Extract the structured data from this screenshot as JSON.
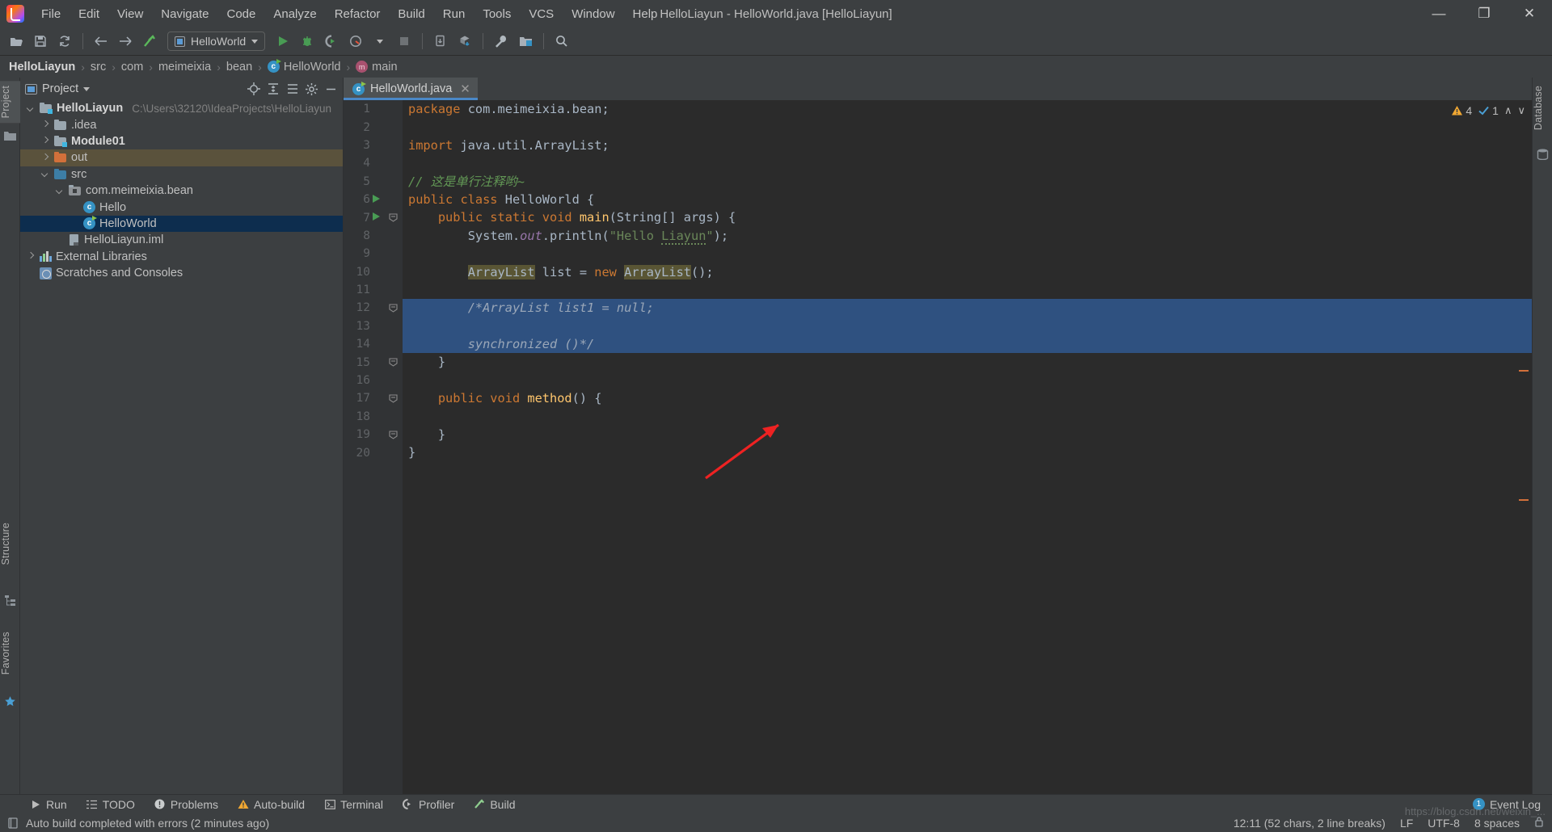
{
  "window": {
    "title": "HelloLiayun - HelloWorld.java [HelloLiayun]",
    "minimize": "—",
    "maximize": "❐",
    "close": "✕"
  },
  "menu": {
    "items": [
      "File",
      "Edit",
      "View",
      "Navigate",
      "Code",
      "Analyze",
      "Refactor",
      "Build",
      "Run",
      "Tools",
      "VCS",
      "Window",
      "Help"
    ]
  },
  "toolbar": {
    "open_label": "open-folder",
    "save_label": "save-all",
    "sync_label": "sync",
    "back_label": "back",
    "forward_label": "forward",
    "build_label": "build-project",
    "run_config": "HelloWorld",
    "run_label": "run",
    "debug_label": "debug",
    "coverage_label": "run-with-coverage",
    "profile_label": "profile",
    "stop_label": "stop",
    "update_label": "update-project",
    "commit_label": "commit",
    "settings_label": "settings",
    "project_structure_label": "project-structure",
    "search_label": "search-everywhere"
  },
  "breadcrumb": {
    "items": [
      {
        "label": "HelloLiayun",
        "icon": "none",
        "strong": true
      },
      {
        "label": "src",
        "icon": "none",
        "strong": false
      },
      {
        "label": "com",
        "icon": "none",
        "strong": false
      },
      {
        "label": "meimeixia",
        "icon": "none",
        "strong": false
      },
      {
        "label": "bean",
        "icon": "none",
        "strong": false
      },
      {
        "label": "HelloWorld",
        "icon": "class",
        "strong": false
      },
      {
        "label": "main",
        "icon": "method",
        "strong": false
      }
    ],
    "separator": "›"
  },
  "left_strip": {
    "project_tab": "Project",
    "structure_tab": "Structure",
    "favorites_tab": "Favorites"
  },
  "right_strip": {
    "database_tab": "Database"
  },
  "project_panel": {
    "title": "Project",
    "caret": "▾",
    "actions": [
      "locate-icon",
      "expand-all-icon",
      "collapse-all-icon",
      "gear-icon",
      "hide-icon"
    ],
    "tree": [
      {
        "indent": 0,
        "arrow": "down",
        "icon": "module",
        "label": "HelloLiayun",
        "bold": true,
        "path": "C:\\Users\\32120\\IdeaProjects\\HelloLiayun",
        "state": "none"
      },
      {
        "indent": 1,
        "arrow": "right",
        "icon": "folder",
        "label": ".idea",
        "bold": false,
        "path": "",
        "state": "none"
      },
      {
        "indent": 1,
        "arrow": "right",
        "icon": "module",
        "label": "Module01",
        "bold": true,
        "path": "",
        "state": "none"
      },
      {
        "indent": 1,
        "arrow": "right",
        "icon": "orange",
        "label": "out",
        "bold": false,
        "path": "",
        "state": "highlight"
      },
      {
        "indent": 1,
        "arrow": "down",
        "icon": "blue",
        "label": "src",
        "bold": false,
        "path": "",
        "state": "none"
      },
      {
        "indent": 2,
        "arrow": "down",
        "icon": "pkg",
        "label": "com.meimeixia.bean",
        "bold": false,
        "path": "",
        "state": "none"
      },
      {
        "indent": 3,
        "arrow": "none",
        "icon": "class",
        "label": "Hello",
        "bold": false,
        "path": "",
        "state": "none"
      },
      {
        "indent": 3,
        "arrow": "none",
        "icon": "class-run",
        "label": "HelloWorld",
        "bold": false,
        "path": "",
        "state": "selected"
      },
      {
        "indent": 2,
        "arrow": "none",
        "icon": "iml",
        "label": "HelloLiayun.iml",
        "bold": false,
        "path": "",
        "state": "none"
      },
      {
        "indent": 0,
        "arrow": "right",
        "icon": "lib",
        "label": "External Libraries",
        "bold": false,
        "path": "",
        "state": "none"
      },
      {
        "indent": 0,
        "arrow": "none",
        "icon": "scratch",
        "label": "Scratches and Consoles",
        "bold": false,
        "path": "",
        "state": "none"
      }
    ]
  },
  "editor": {
    "tab": {
      "label": "HelloWorld.java",
      "close": "✕",
      "icon": "class-run"
    },
    "inspection": {
      "warn_count": "4",
      "warn_icon": "warning-triangle",
      "ok_count": "1",
      "ok_icon": "check-mark",
      "up": "∧",
      "down": "∨"
    },
    "line_numbers": [
      "1",
      "2",
      "3",
      "4",
      "5",
      "6",
      "7",
      "8",
      "9",
      "10",
      "11",
      "12",
      "13",
      "14",
      "15",
      "16",
      "17",
      "18",
      "19",
      "20"
    ],
    "lines": [
      {
        "n": 1,
        "indent": 0,
        "tokens": [
          {
            "t": "package ",
            "c": "kw"
          },
          {
            "t": "com.meimeixia.bean;",
            "c": "plain"
          }
        ]
      },
      {
        "n": 2,
        "indent": 0,
        "tokens": []
      },
      {
        "n": 3,
        "indent": 0,
        "tokens": [
          {
            "t": "import ",
            "c": "kw"
          },
          {
            "t": "java.util.ArrayList;",
            "c": "plain"
          }
        ]
      },
      {
        "n": 4,
        "indent": 0,
        "tokens": []
      },
      {
        "n": 5,
        "indent": 0,
        "tokens": [
          {
            "t": "// 这是单行注释哟~",
            "c": "cmt"
          }
        ]
      },
      {
        "n": 6,
        "indent": 0,
        "tokens": [
          {
            "t": "public class ",
            "c": "kw"
          },
          {
            "t": "HelloWorld",
            "c": "plain"
          },
          {
            "t": " {",
            "c": "plain"
          }
        ],
        "run_marker": true
      },
      {
        "n": 7,
        "indent": 1,
        "tokens": [
          {
            "t": "public static void ",
            "c": "kw"
          },
          {
            "t": "main",
            "c": "fn"
          },
          {
            "t": "(String[] args) {",
            "c": "plain"
          }
        ],
        "run_marker": true,
        "fold": true
      },
      {
        "n": 8,
        "indent": 2,
        "tokens": [
          {
            "t": "System.",
            "c": "plain"
          },
          {
            "t": "out",
            "c": "fld"
          },
          {
            "t": ".println(",
            "c": "plain"
          },
          {
            "t": "\"Hello ",
            "c": "str"
          },
          {
            "t": "Liayun",
            "c": "str-squiggle"
          },
          {
            "t": "\"",
            "c": "str"
          },
          {
            "t": ");",
            "c": "plain"
          }
        ]
      },
      {
        "n": 9,
        "indent": 0,
        "tokens": []
      },
      {
        "n": 10,
        "indent": 2,
        "tokens": [
          {
            "t": "ArrayList",
            "c": "hlid"
          },
          {
            "t": " list = ",
            "c": "plain"
          },
          {
            "t": "new ",
            "c": "kw"
          },
          {
            "t": "ArrayList",
            "c": "hlid"
          },
          {
            "t": "();",
            "c": "plain"
          }
        ]
      },
      {
        "n": 11,
        "indent": 0,
        "tokens": []
      },
      {
        "n": 12,
        "indent": 2,
        "tokens": [
          {
            "t": "/*ArrayList list1 = null;",
            "c": "cmt-sel"
          }
        ],
        "selected": true,
        "bulb": true,
        "fold": true
      },
      {
        "n": 13,
        "indent": 0,
        "tokens": [],
        "selected": true
      },
      {
        "n": 14,
        "indent": 2,
        "tokens": [
          {
            "t": "synchronized ()*/",
            "c": "cmt-sel"
          }
        ],
        "selected": true
      },
      {
        "n": 15,
        "indent": 1,
        "tokens": [
          {
            "t": "}",
            "c": "plain"
          }
        ],
        "fold": true
      },
      {
        "n": 16,
        "indent": 0,
        "tokens": []
      },
      {
        "n": 17,
        "indent": 1,
        "tokens": [
          {
            "t": "public void ",
            "c": "kw"
          },
          {
            "t": "method",
            "c": "fn"
          },
          {
            "t": "() {",
            "c": "plain"
          }
        ],
        "fold": true
      },
      {
        "n": 18,
        "indent": 0,
        "tokens": []
      },
      {
        "n": 19,
        "indent": 1,
        "tokens": [
          {
            "t": "}",
            "c": "plain"
          }
        ],
        "fold": true
      },
      {
        "n": 20,
        "indent": 0,
        "tokens": [
          {
            "t": "}",
            "c": "plain"
          }
        ]
      }
    ]
  },
  "bottom_tabs": [
    {
      "label": "Run",
      "icon": "play-icon"
    },
    {
      "label": "TODO",
      "icon": "list-icon"
    },
    {
      "label": "Problems",
      "icon": "error-icon"
    },
    {
      "label": "Auto-build",
      "icon": "warning-icon"
    },
    {
      "label": "Terminal",
      "icon": "terminal-icon"
    },
    {
      "label": "Profiler",
      "icon": "profiler-icon"
    },
    {
      "label": "Build",
      "icon": "hammer-icon"
    }
  ],
  "event_log": {
    "label": "Event Log",
    "count": "1"
  },
  "status": {
    "message": "Auto build completed with errors (2 minutes ago)",
    "caret": "12:11 (52 chars, 2 line breaks)",
    "line_sep": "LF",
    "encoding": "UTF-8",
    "indent": "8 spaces"
  },
  "watermark": "https://blog.csdn.net/weixin_...",
  "colors": {
    "accent_blue": "#4a88c7",
    "selection": "#2f5180",
    "tree_selection": "#0d2d4e",
    "editor_bg": "#2b2b2b",
    "panel_bg": "#3c3f41",
    "gutter_bg": "#313335",
    "keyword": "#cc7832",
    "string": "#6a8759",
    "comment": "#629755",
    "field": "#9876aa",
    "method": "#ffc66d",
    "warning": "#f0a732",
    "run_green": "#499c54",
    "highlight_row": "#5a523c",
    "arrow_red": "#ee2222"
  }
}
